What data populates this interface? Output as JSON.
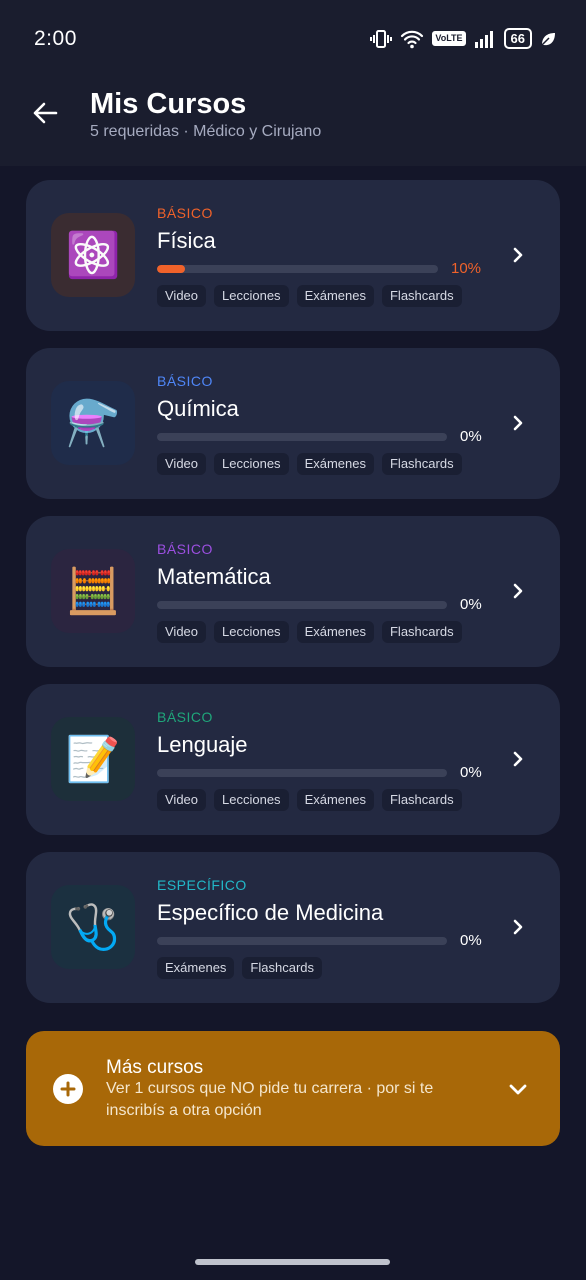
{
  "status_bar": {
    "time": "2:00",
    "volte": "VoLTE",
    "battery": "66"
  },
  "header": {
    "title": "Mis Cursos",
    "subtitle": "5 requeridas · Médico y Cirujano"
  },
  "courses": [
    {
      "tag": "BÁSICO",
      "tag_color": "#f0622a",
      "name": "Física",
      "icon": "atom-icon",
      "emoji": "⚛️",
      "icon_bg": "#3a2c31",
      "progress": 10,
      "progress_label": "10%",
      "progress_color": "#f0622a",
      "pct_color": "#f0622a",
      "chips": [
        "Video",
        "Lecciones",
        "Exámenes",
        "Flashcards"
      ]
    },
    {
      "tag": "BÁSICO",
      "tag_color": "#4f86f7",
      "name": "Química",
      "icon": "flask-icon",
      "emoji": "⚗️",
      "icon_bg": "#1f2c4a",
      "progress": 0,
      "progress_label": "0%",
      "progress_color": "#4f86f7",
      "pct_color": "#ffffff",
      "chips": [
        "Video",
        "Lecciones",
        "Exámenes",
        "Flashcards"
      ]
    },
    {
      "tag": "BÁSICO",
      "tag_color": "#9b4fe0",
      "name": "Matemática",
      "icon": "abacus-icon",
      "emoji": "🧮",
      "icon_bg": "#2b2540",
      "progress": 0,
      "progress_label": "0%",
      "progress_color": "#9b4fe0",
      "pct_color": "#ffffff",
      "chips": [
        "Video",
        "Lecciones",
        "Exámenes",
        "Flashcards"
      ]
    },
    {
      "tag": "BÁSICO",
      "tag_color": "#1fa67a",
      "name": "Lenguaje",
      "icon": "memo-icon",
      "emoji": "📝",
      "icon_bg": "#1d2f3a",
      "progress": 0,
      "progress_label": "0%",
      "progress_color": "#1fa67a",
      "pct_color": "#ffffff",
      "chips": [
        "Video",
        "Lecciones",
        "Exámenes",
        "Flashcards"
      ]
    },
    {
      "tag": "ESPECÍFICO",
      "tag_color": "#22b8c8",
      "name": "Específico de Medicina",
      "icon": "stethoscope-icon",
      "emoji": "🩺",
      "icon_bg": "#1b3040",
      "progress": 0,
      "progress_label": "0%",
      "progress_color": "#22b8c8",
      "pct_color": "#ffffff",
      "chips": [
        "Exámenes",
        "Flashcards"
      ]
    }
  ],
  "more_courses": {
    "title": "Más cursos",
    "description": "Ver 1 cursos que NO pide tu carrera · por si te inscribís a otra opción"
  }
}
